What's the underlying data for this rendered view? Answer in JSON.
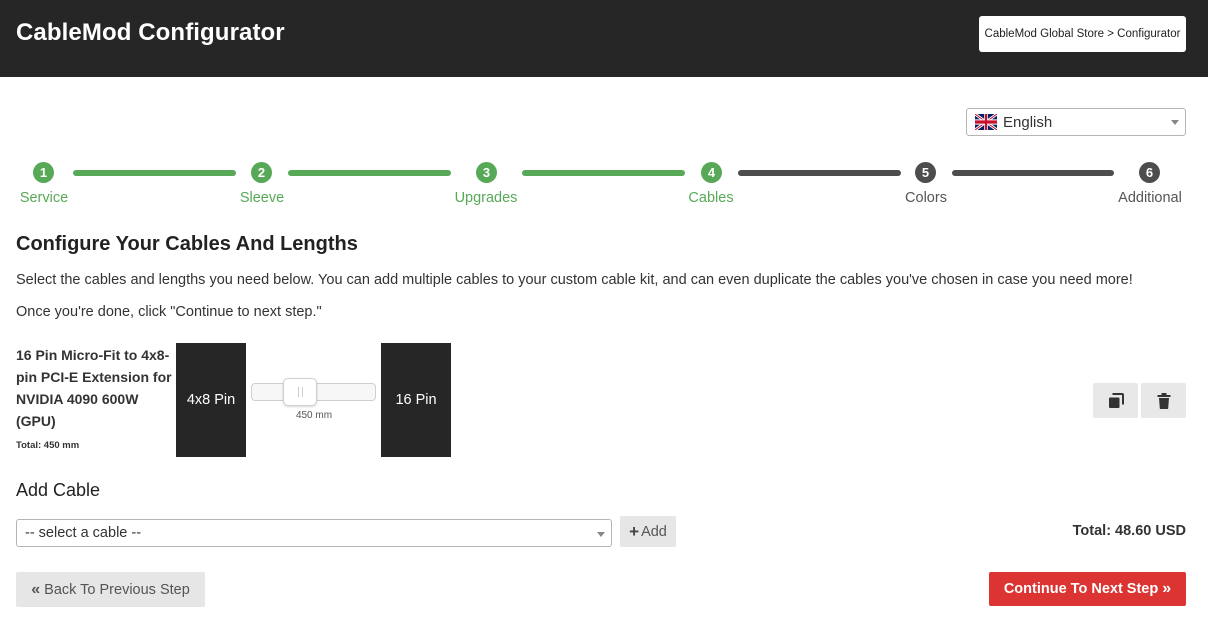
{
  "header": {
    "app_title": "CableMod Configurator",
    "store_link": "CableMod Global Store > Configurator"
  },
  "language": {
    "selected": "English",
    "flag_icon": "uk-flag-icon"
  },
  "steps": [
    {
      "number": "1",
      "label": "Service",
      "status": "done"
    },
    {
      "number": "2",
      "label": "Sleeve",
      "status": "done"
    },
    {
      "number": "3",
      "label": "Upgrades",
      "status": "done"
    },
    {
      "number": "4",
      "label": "Cables",
      "status": "done"
    },
    {
      "number": "5",
      "label": "Colors",
      "status": "todo"
    },
    {
      "number": "6",
      "label": "Additional",
      "status": "todo"
    }
  ],
  "main": {
    "heading": "Configure Your Cables And Lengths",
    "intro_1": "Select the cables and lengths you need below. You can add multiple cables to your custom cable kit, and can even duplicate the cables you've chosen in case you need more!",
    "intro_2": "Once you're done, click \"Continue to next step.\""
  },
  "cable": {
    "name": "16 Pin Micro-Fit to 4x8-pin PCI-E Extension for NVIDIA 4090 600W (GPU)",
    "total_length": "Total: 450 mm",
    "left_connector": "4x8 Pin",
    "right_connector": "16 Pin",
    "length_value": "450 mm",
    "duplicate_icon": "copy-icon",
    "delete_icon": "trash-icon"
  },
  "add_cable": {
    "heading": "Add Cable",
    "select_placeholder": "-- select a cable --",
    "add_label": "Add"
  },
  "totals": {
    "price": "Total: 48.60 USD"
  },
  "footer": {
    "back_label": "Back To Previous Step",
    "next_label": "Continue To Next Step"
  },
  "colors": {
    "header_bg": "#262626",
    "done": "#57a957",
    "todo": "#4d4d4d",
    "accent_red": "#dc3333"
  }
}
